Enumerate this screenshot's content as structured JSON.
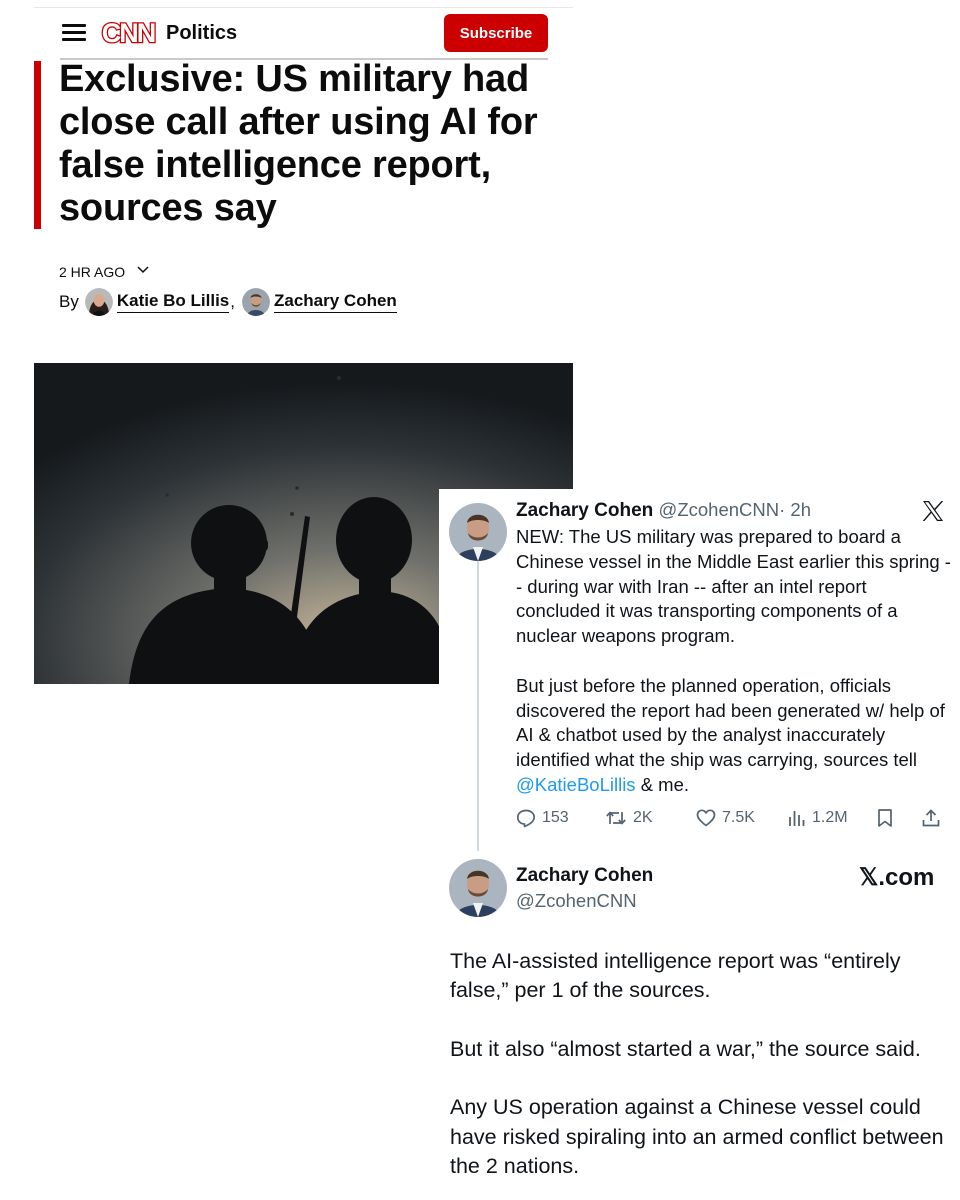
{
  "header": {
    "section": "Politics",
    "subscribe_label": "Subscribe",
    "logo_text": "CNN",
    "accent_color": "#cc0000"
  },
  "article": {
    "headline": "Exclusive: US military had close call after using AI for false intelligence report, sources say",
    "timestamp": "2 HR AGO",
    "byline_prefix": "By",
    "authors": [
      "Katie Bo Lillis",
      "Zachary Cohen"
    ],
    "separator": ","
  },
  "tweet": {
    "name": "Zachary Cohen",
    "handle": "@ZcohenCNN",
    "time": "· 2h",
    "paragraph1": "NEW: The US military was prepared to board a Chinese vessel in the Middle East earlier this spring -- during war with Iran -- after an intel report concluded it was transporting components of a nuclear weapons program.",
    "paragraph2_pre": "But just before the planned operation, officials discovered the report had been generated w/ help of AI & chatbot used by the analyst inaccurately identified what the ship was carrying, sources tell ",
    "mention": "@KatieBoLillis",
    "paragraph2_post": " & me.",
    "stats": {
      "replies": "153",
      "reposts": "2K",
      "likes": "7.5K",
      "views": "1.2M"
    },
    "mention_color": "#1d9bf0"
  },
  "reply": {
    "name": "Zachary Cohen",
    "handle": "@ZcohenCNN",
    "source_label": "𝕏.com",
    "paragraphs": [
      "The AI-assisted intelligence report was “entirely false,” per 1 of the sources.",
      "But it also “almost started a war,” the source said.",
      "Any US operation against a Chinese vessel could have risked spiraling into an armed conflict between the 2 nations."
    ]
  }
}
